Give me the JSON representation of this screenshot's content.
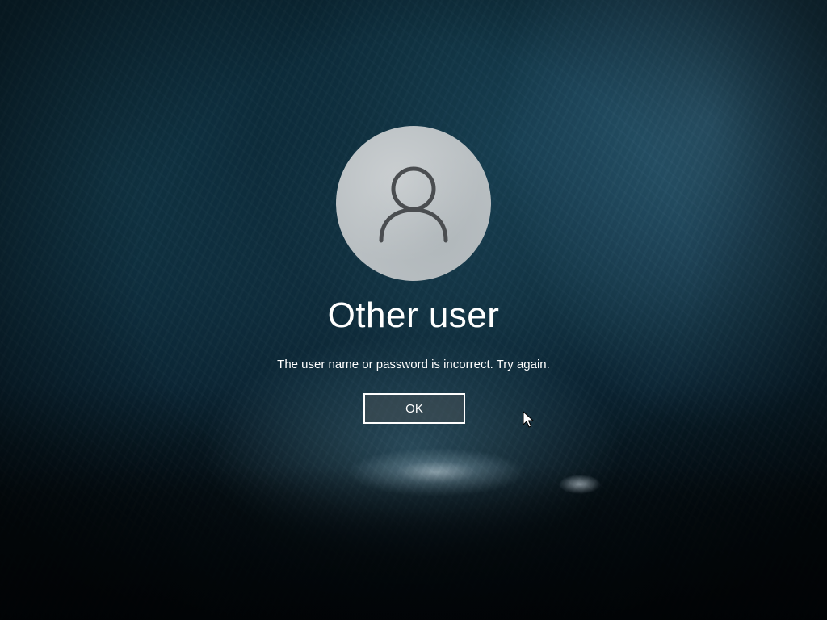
{
  "lock_screen": {
    "user_name": "Other user",
    "message": "The user name or password is incorrect. Try again.",
    "ok_label": "OK"
  },
  "icons": {
    "avatar": "user-silhouette-icon",
    "cursor": "mouse-pointer-icon"
  },
  "colors": {
    "background": "#0b2634",
    "avatar_fill": "#b9bfc2",
    "avatar_glyph": "#4a4d50",
    "text": "#ffffff",
    "button_border": "#ffffff"
  }
}
